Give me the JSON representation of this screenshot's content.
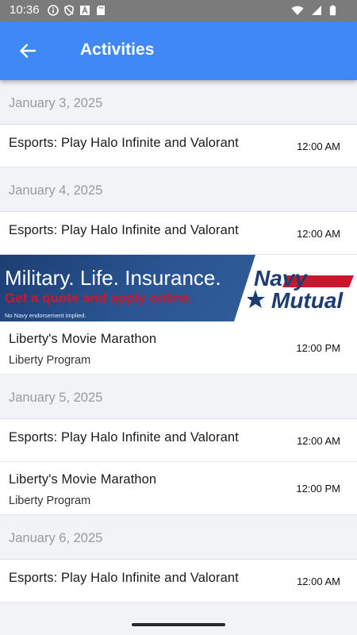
{
  "status_bar": {
    "time": "10:36"
  },
  "app_bar": {
    "title": "Activities"
  },
  "sections": [
    {
      "date": "January 3, 2025",
      "items": [
        {
          "title": "Esports: Play Halo Infinite and Valorant",
          "time": "12:00 AM"
        }
      ]
    },
    {
      "date": "January 4, 2025",
      "items": [
        {
          "title": "Esports: Play Halo Infinite and Valorant",
          "time": "12:00 AM"
        },
        {
          "title": "Liberty's Movie Marathon",
          "subtitle": "Liberty Program",
          "time": "12:00 PM"
        }
      ]
    },
    {
      "date": "January 5, 2025",
      "items": [
        {
          "title": "Esports: Play Halo Infinite and Valorant",
          "time": "12:00 AM"
        },
        {
          "title": "Liberty's Movie Marathon",
          "subtitle": "Liberty Program",
          "time": "12:00 PM"
        }
      ]
    },
    {
      "date": "January 6, 2025",
      "items": [
        {
          "title": "Esports: Play Halo Infinite and Valorant",
          "time": "12:00 AM"
        }
      ]
    }
  ],
  "ad": {
    "headline": "Military. Life. Insurance.",
    "subline": "Get a quote and apply online.",
    "note": "No Navy endorsement implied.",
    "logo_line1": "Navy",
    "logo_line2": "Mutual",
    "colors": {
      "navy": "#1d3d72",
      "red": "#c8182d"
    }
  },
  "colors": {
    "app_bar": "#3f88f6",
    "background": "#f2f3f7",
    "status_bar": "#7b7b7b"
  }
}
